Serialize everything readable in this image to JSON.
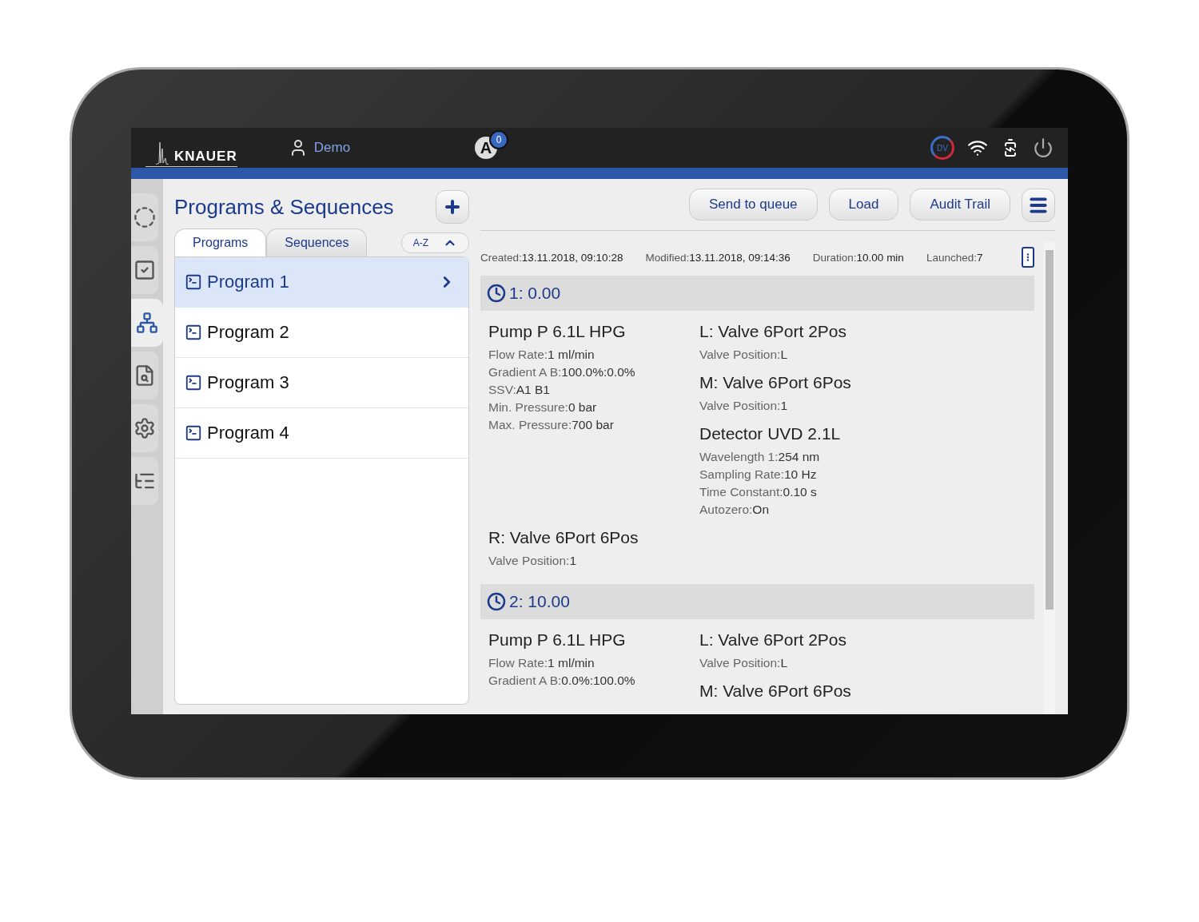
{
  "header": {
    "logo": "KNAUER",
    "user": "Demo",
    "auto_label": "A",
    "auto_count": "0",
    "device_label": "DV"
  },
  "sidebar": {
    "items": [
      {
        "kind": "status",
        "selected": false
      },
      {
        "kind": "tasks",
        "selected": false
      },
      {
        "kind": "programs",
        "selected": true
      },
      {
        "kind": "data",
        "selected": false
      },
      {
        "kind": "settings",
        "selected": false
      },
      {
        "kind": "list",
        "selected": false
      }
    ]
  },
  "title": "Programs & Sequences",
  "tabs": [
    {
      "label": "Programs",
      "selected": true
    },
    {
      "label": "Sequences",
      "selected": false
    }
  ],
  "sort": {
    "label": "A-Z"
  },
  "programs": [
    {
      "name": "Program 1",
      "selected": true
    },
    {
      "name": "Program 2",
      "selected": false
    },
    {
      "name": "Program 3",
      "selected": false
    },
    {
      "name": "Program 4",
      "selected": false
    }
  ],
  "toolbar": [
    "Send to queue",
    "Load",
    "Audit Trail"
  ],
  "meta": [
    {
      "label": "Created:",
      "value": "13.11.2018, 09:10:28"
    },
    {
      "label": "Modified:",
      "value": "13.11.2018, 09:14:36"
    },
    {
      "label": "Duration:",
      "value": "10.00 min"
    },
    {
      "label": "Launched:",
      "value": "7"
    }
  ],
  "steps": [
    {
      "time": "1: 0.00",
      "columns": [
        [
          {
            "name": "Pump P 6.1L HPG",
            "props": [
              {
                "label": "Flow Rate:",
                "value": "1 ml/min"
              },
              {
                "label": "Gradient A B:",
                "value": "100.0%:0.0%"
              },
              {
                "label": "SSV:",
                "value": "A1 B1"
              },
              {
                "label": "Min. Pressure:",
                "value": "0 bar"
              },
              {
                "label": "Max. Pressure:",
                "value": "700 bar"
              }
            ]
          }
        ],
        [
          {
            "name": "L: Valve 6Port 2Pos",
            "props": [
              {
                "label": "Valve Position:",
                "value": "L"
              }
            ]
          },
          {
            "name": "M: Valve 6Port 6Pos",
            "props": [
              {
                "label": "Valve Position:",
                "value": "1"
              }
            ]
          },
          {
            "name": "Detector UVD 2.1L",
            "props": [
              {
                "label": "Wavelength 1:",
                "value": "254 nm"
              },
              {
                "label": "Sampling Rate:",
                "value": "10 Hz"
              },
              {
                "label": "Time Constant:",
                "value": "0.10 s"
              },
              {
                "label": "Autozero:",
                "value": "On"
              }
            ]
          }
        ]
      ],
      "footer": [
        {
          "name": "R: Valve 6Port 6Pos",
          "props": [
            {
              "label": "Valve Position:",
              "value": "1"
            }
          ]
        }
      ]
    },
    {
      "time": "2: 10.00",
      "columns": [
        [
          {
            "name": "Pump P 6.1L HPG",
            "props": [
              {
                "label": "Flow Rate:",
                "value": "1 ml/min"
              },
              {
                "label": "Gradient A B:",
                "value": "0.0%:100.0%"
              }
            ]
          }
        ],
        [
          {
            "name": "L: Valve 6Port 2Pos",
            "props": [
              {
                "label": "Valve Position:",
                "value": "L"
              }
            ]
          },
          {
            "name": "M: Valve 6Port 6Pos"
          }
        ]
      ]
    }
  ]
}
